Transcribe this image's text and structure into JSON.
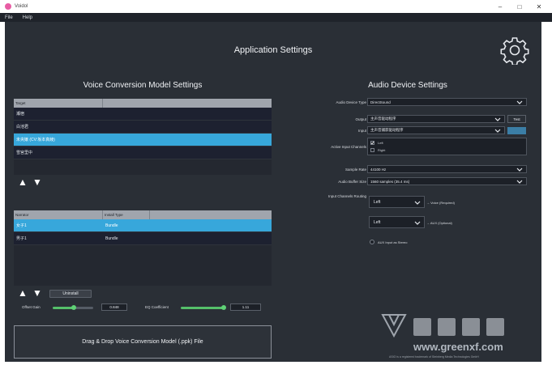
{
  "window": {
    "title": "Voidol"
  },
  "menu": [
    {
      "label": "File"
    },
    {
      "label": "Help"
    }
  ],
  "app_title": "Application Settings",
  "vc": {
    "title": "Voice Conversion Model Settings",
    "target_table": {
      "header": "Target",
      "rows": [
        "瀬宿",
        "白池君",
        "未央嬢 (CV:坂本真綾)",
        "雪宮里中"
      ],
      "selected_index": 2
    },
    "model_table": {
      "headers": [
        "Narrator",
        "Install Type"
      ],
      "rows": [
        [
          "女子1",
          "Bundle"
        ],
        [
          "男子1",
          "Bundle"
        ]
      ],
      "selected_index": 0
    },
    "uninstall_label": "Uninstall",
    "offset_gain": {
      "label": "Offset Gain",
      "value": "0.848",
      "fraction": 0.3
    },
    "eq_coefficient": {
      "label": "EQ Coefficient",
      "value": "1.11",
      "fraction": 0.9
    },
    "drop_label": "Drag & Drop Voice Conversion Model (.ppk) File"
  },
  "audio": {
    "title": "Audio Device Settings",
    "device_type": {
      "label": "Audio Device Type",
      "value": "DirectSound"
    },
    "output": {
      "label": "Output",
      "value": "主声音驱动程序",
      "test_label": "Test"
    },
    "input": {
      "label": "Input",
      "value": "主声音捕获驱动程序",
      "level_color": "#3b7ea6"
    },
    "active_channels": {
      "label": "Active Input Channels",
      "items": [
        {
          "label": "Left",
          "checked": true
        },
        {
          "label": "Right",
          "checked": false
        }
      ]
    },
    "sample_rate": {
      "label": "Sample Rate",
      "value": "44100 Hz"
    },
    "buffer_size": {
      "label": "Audio Buffer Size",
      "value": "1560 samples (35.4 ms)"
    },
    "routing": {
      "label": "Input Channels Routing",
      "rows": [
        {
          "value": "Left",
          "target": "→ Voice (Required)"
        },
        {
          "value": "Left",
          "target": "→ AUX (Optional)"
        }
      ]
    },
    "aux_stereo": {
      "label": "AUX Input as Stereo"
    }
  },
  "footer_note": "ASIO is a registered trademark of Steinberg Media Technologies GmbH",
  "watermark_text": "www.greenxf.com",
  "colors": {
    "accent": "#37a7db",
    "slider": "#5fd176",
    "bg": "#2a2f36"
  }
}
